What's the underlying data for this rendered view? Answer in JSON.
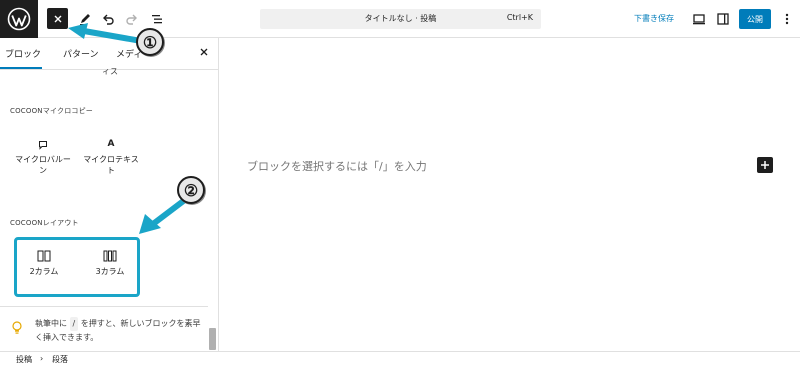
{
  "header": {
    "post_title": "タイトルなし · 投稿",
    "shortcut": "Ctrl+K",
    "save_draft": "下書き保存",
    "publish": "公開"
  },
  "inserter": {
    "tabs": [
      "ブロック",
      "パターン",
      "メディ"
    ],
    "cut_text": "ィス",
    "groups": [
      {
        "title": "COCOONマイクロコピー",
        "items": [
          {
            "label": "マイクロバルーン",
            "icon": "speech-bubble-icon"
          },
          {
            "label": "マイクロテキスト",
            "icon": "letter-a-icon"
          }
        ]
      },
      {
        "title": "COCOONレイアウト",
        "items": [
          {
            "label": "2カラム",
            "icon": "two-columns-icon"
          },
          {
            "label": "3カラム",
            "icon": "three-columns-icon"
          }
        ]
      }
    ],
    "tip": {
      "before": "執筆中に",
      "key": "/",
      "after": "を押すと、新しいブロックを素早く挿入できます。"
    }
  },
  "editor": {
    "placeholder": "ブロックを選択するには「/」を入力"
  },
  "breadcrumb": [
    "投稿",
    "段落"
  ],
  "annotations": {
    "badge_1": "①",
    "badge_2": "②",
    "accent_color": "#1aa5c8"
  },
  "colors": {
    "brand_blue": "#007cba",
    "dark": "#1e1e1e"
  }
}
